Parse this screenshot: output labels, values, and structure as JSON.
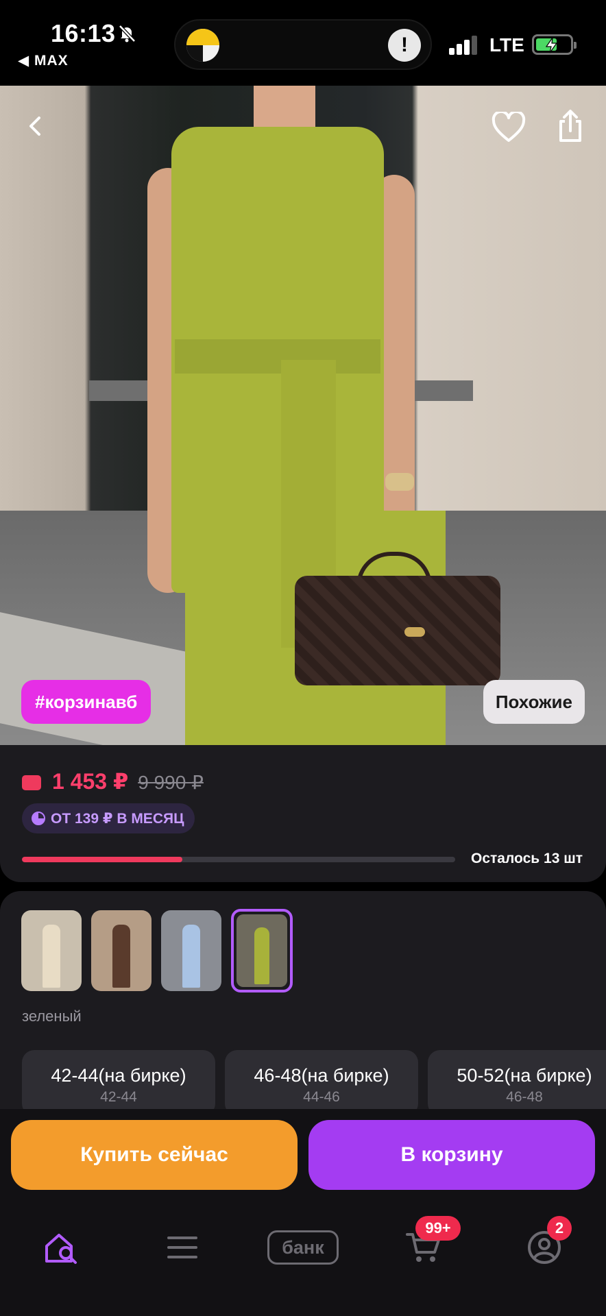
{
  "status_bar": {
    "time": "16:13",
    "back_app": "◀ MAX",
    "network": "LTE",
    "icons": [
      "bell-mute-icon",
      "signal-icon",
      "battery-charging-icon",
      "alert-icon"
    ]
  },
  "hero": {
    "tag_label": "#корзинавб",
    "similar_label": "Похожие",
    "icons": [
      "back-icon",
      "heart-icon",
      "share-icon"
    ]
  },
  "price_card": {
    "price": "1 453 ₽",
    "old_price": "9 990 ₽",
    "installment": "ОТ 139 ₽ В МЕСЯЦ",
    "stock_label": "Осталось 13 шт",
    "stock_progress": 0.37,
    "colors": {
      "price": "#ff3f6c",
      "installment": "#c79bff",
      "progress": "#ef3a5d"
    }
  },
  "variants": {
    "selected_color": "зеленый",
    "thumbnails": [
      {
        "name": "beige",
        "bg": "#c9bfae",
        "fig": "#e8dcc5"
      },
      {
        "name": "brown",
        "bg": "#b59d86",
        "fig": "#5a3b2c"
      },
      {
        "name": "blue",
        "bg": "#8a8d94",
        "fig": "#a9c3e4"
      },
      {
        "name": "green",
        "bg": "#6e6a5d",
        "fig": "#a8b23a",
        "selected": true
      }
    ],
    "sizes": [
      {
        "label": "42-44(на бирке)",
        "sub": "42-44"
      },
      {
        "label": "46-48(на бирке)",
        "sub": "44-46"
      },
      {
        "label": "50-52(на бирке)",
        "sub": "46-48"
      }
    ]
  },
  "actions": {
    "buy_now": "Купить сейчас",
    "add_to_cart": "В корзину",
    "colors": {
      "buy_now": "#f39c2c",
      "add_to_cart": "#a43cf2"
    }
  },
  "bottom_nav": {
    "bank_label": "банк",
    "cart_badge": "99+",
    "profile_badge": "2",
    "items": [
      "home-search-icon",
      "menu-icon",
      "bank-icon",
      "cart-icon",
      "profile-icon"
    ]
  }
}
